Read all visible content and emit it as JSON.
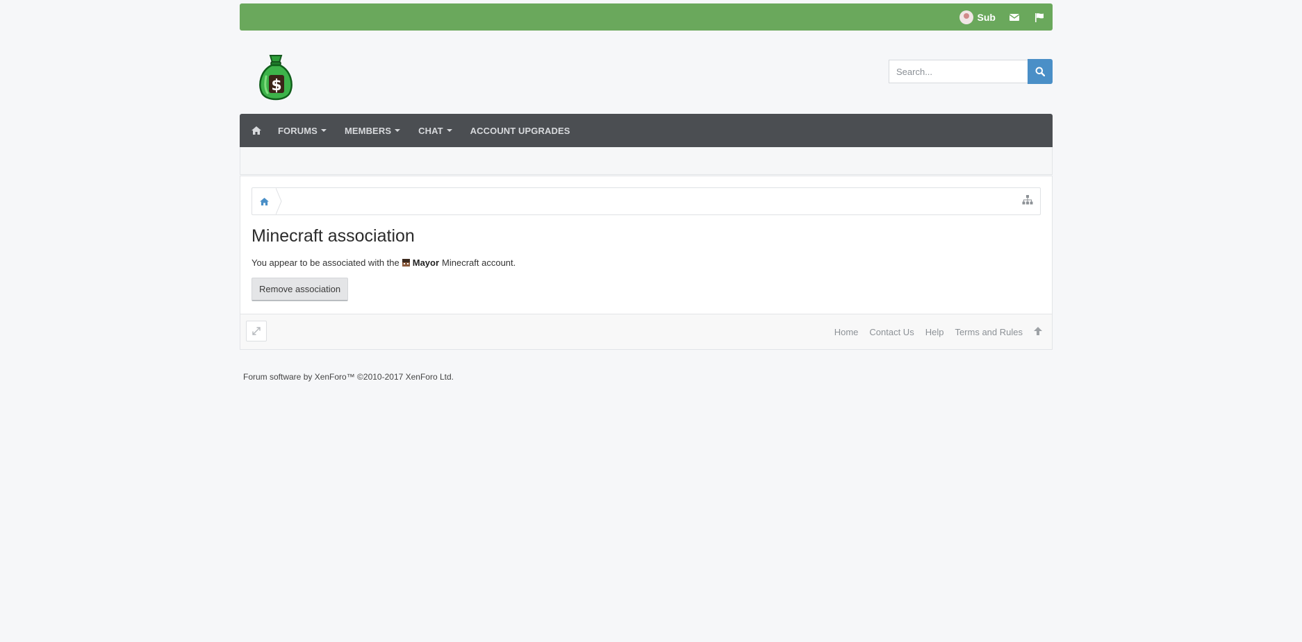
{
  "topbar": {
    "username": "Sub",
    "icons": [
      "avatar",
      "envelope-icon",
      "flag-icon"
    ]
  },
  "header": {
    "logo": "money-bag-dollar-logo",
    "search": {
      "placeholder": "Search...",
      "icon": "search-icon"
    }
  },
  "nav": {
    "home_icon": "home-icon",
    "items": [
      {
        "label": "FORUMS",
        "dropdown": true
      },
      {
        "label": "MEMBERS",
        "dropdown": true
      },
      {
        "label": "CHAT",
        "dropdown": true
      },
      {
        "label": "ACCOUNT UPGRADES",
        "dropdown": false
      }
    ]
  },
  "breadcrumb": {
    "home_icon": "home-icon",
    "sitemap_icon": "sitemap-icon"
  },
  "main": {
    "title": "Minecraft association",
    "message_prefix": "You appear to be associated with the",
    "account_name": "Mayor",
    "message_suffix": "Minecraft account.",
    "remove_button": "Remove association"
  },
  "footer": {
    "expand_icon": "expand-icon",
    "links": [
      "Home",
      "Contact Us",
      "Help",
      "Terms and Rules"
    ],
    "top_icon": "arrow-up-icon",
    "copyright": "Forum software by XenForo™ ©2010-2017 XenForo Ltd."
  },
  "colors": {
    "topbar": "#6aa85c",
    "nav": "#4b4e52",
    "search_button": "#4a8fc7",
    "background": "#f6f7f9"
  }
}
